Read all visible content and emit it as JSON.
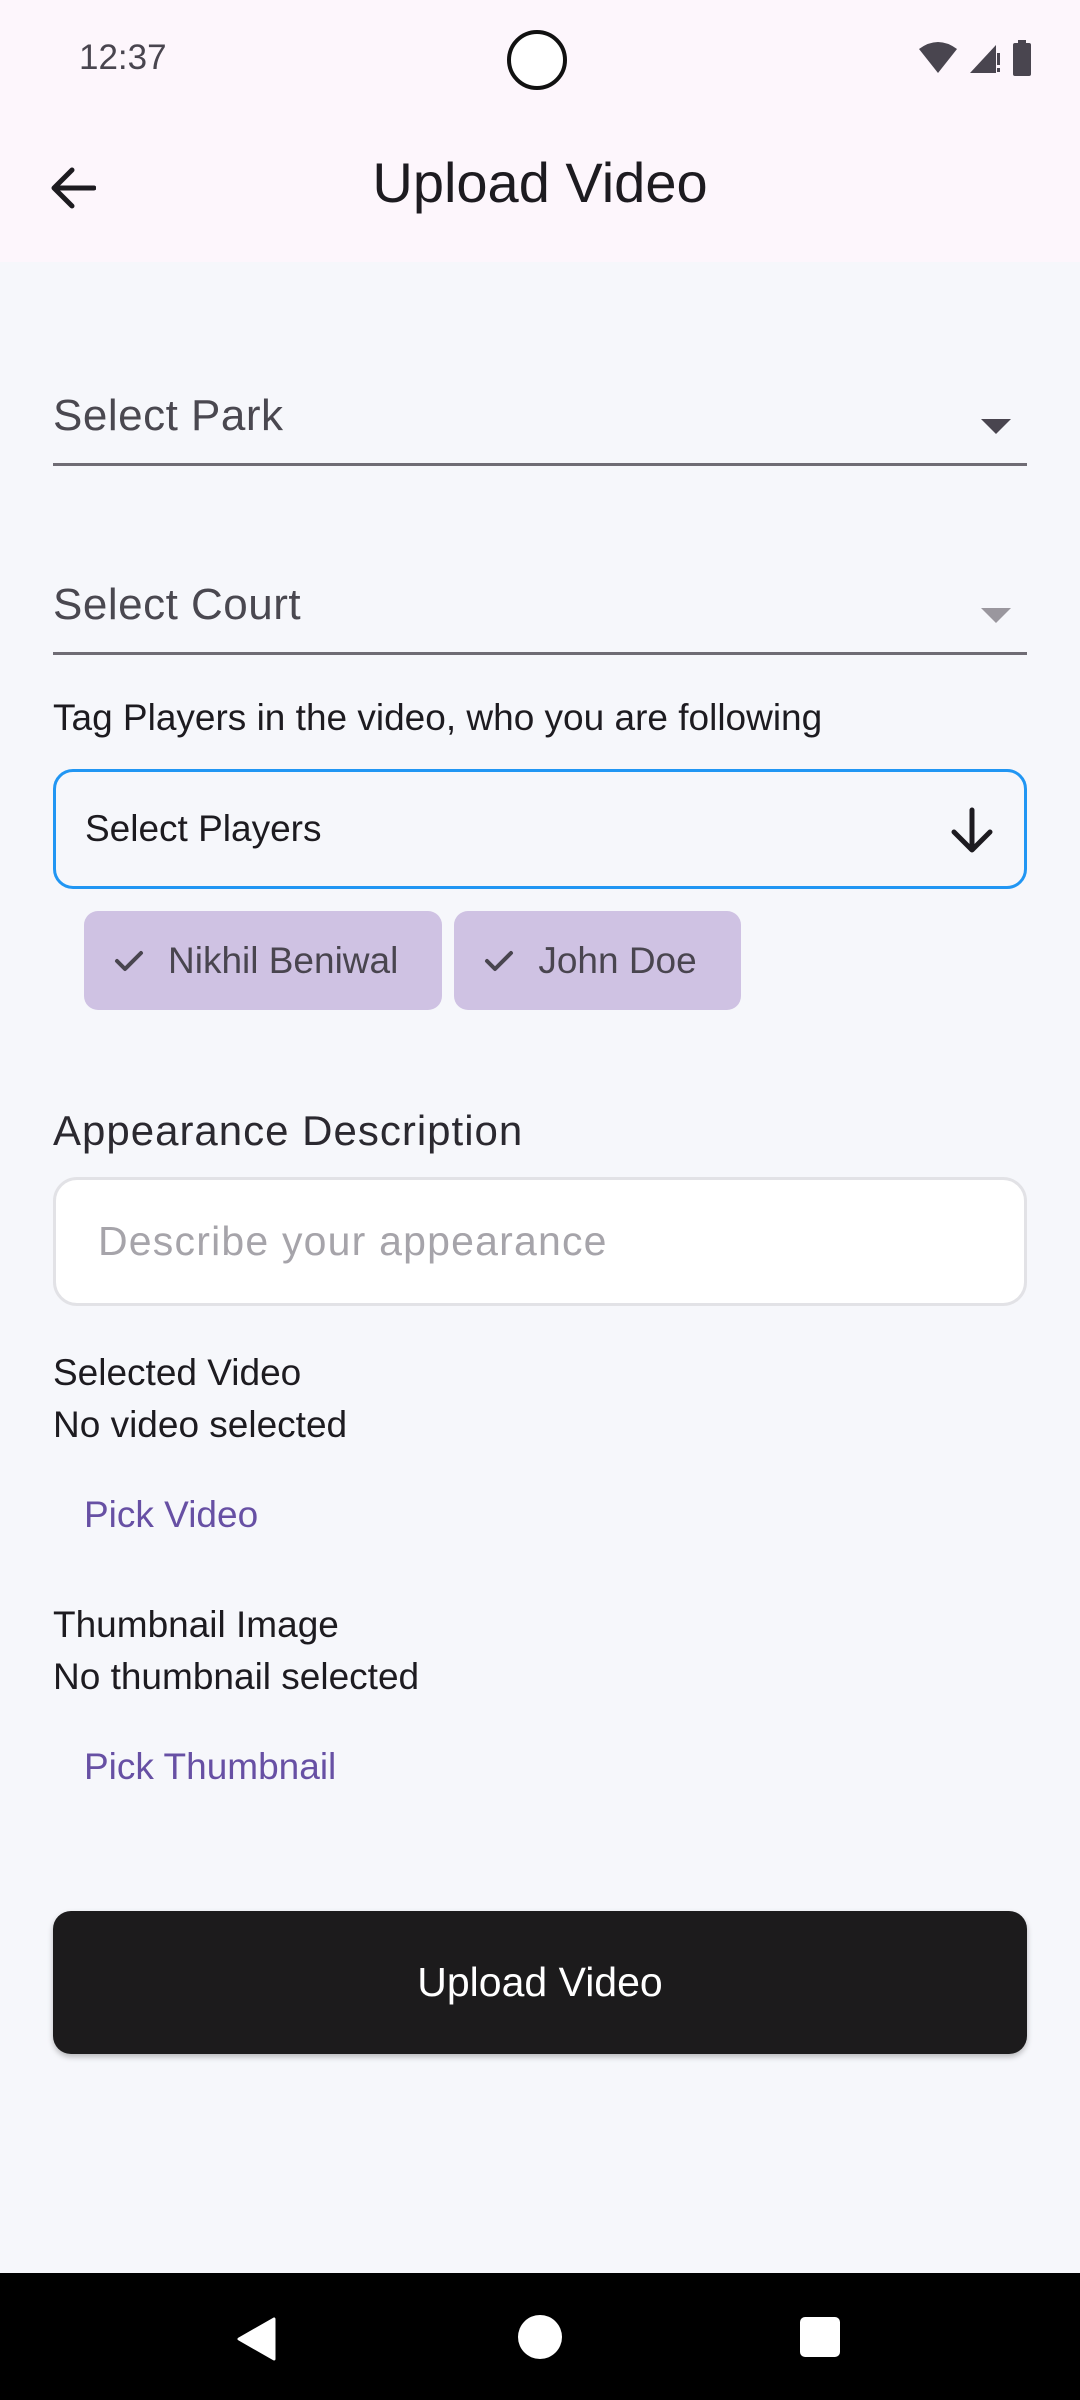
{
  "status_bar": {
    "time": "12:37",
    "icons": [
      "wifi-icon",
      "cell-signal-icon",
      "battery-icon"
    ]
  },
  "app_bar": {
    "title": "Upload Video",
    "back_icon": "arrow-left-icon"
  },
  "form": {
    "park_dropdown": {
      "label": "Select Park"
    },
    "court_dropdown": {
      "label": "Select Court",
      "enabled": false
    },
    "tag_players_label": "Tag Players in the video, who you are following",
    "players_select": {
      "label": "Select Players",
      "icon": "arrow-down-icon"
    },
    "selected_players": [
      {
        "name": "Nikhil Beniwal",
        "icon": "check-icon"
      },
      {
        "name": "John Doe",
        "icon": "check-icon"
      }
    ],
    "appearance": {
      "heading": "Appearance Description",
      "placeholder": "Describe your appearance",
      "value": ""
    },
    "video": {
      "heading": "Selected Video",
      "status": "No video selected",
      "pick_label": "Pick Video"
    },
    "thumbnail": {
      "heading": "Thumbnail Image",
      "status": "No thumbnail selected",
      "pick_label": "Pick Thumbnail"
    },
    "submit_label": "Upload Video"
  },
  "colors": {
    "accent": "#6750a4",
    "focus_border": "#2196f3",
    "chip_bg": "#cfc2e3",
    "button_bg": "#1c1b1c",
    "app_bar_bg": "#fdf6fc",
    "page_bg": "#f6f7fb"
  }
}
